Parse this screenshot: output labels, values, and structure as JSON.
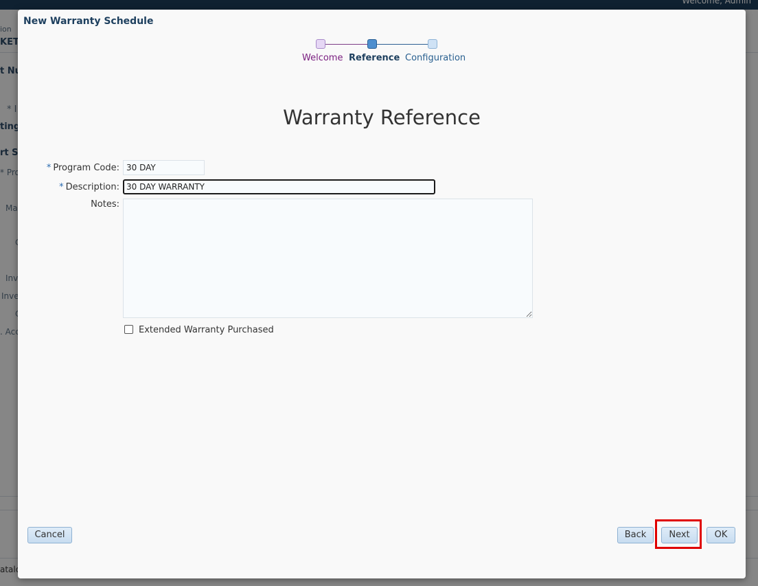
{
  "background": {
    "welcome_text": "Welcome, Admin",
    "side_fragments": [
      "ion",
      "KET",
      "t Nu",
      "* I",
      "ting",
      "rt Se",
      "* Pro",
      "Ma",
      "C",
      "Inv",
      "Inve",
      "C",
      ". Acc"
    ],
    "bottom_fragment": "atalo"
  },
  "dialog": {
    "title": "New Warranty Schedule",
    "train": {
      "steps": [
        {
          "label": "Welcome",
          "state": "visited"
        },
        {
          "label": "Reference",
          "state": "current"
        },
        {
          "label": "Configuration",
          "state": "unvisited"
        }
      ]
    },
    "heading": "Warranty Reference",
    "form": {
      "program_code": {
        "label": "Program Code:",
        "required": "*",
        "value": "30 DAY"
      },
      "description": {
        "label": "Description:",
        "required": "*",
        "value": "30 DAY WARRANTY"
      },
      "notes": {
        "label": "Notes:",
        "value": ""
      },
      "extended_warranty": {
        "label": "Extended Warranty Purchased",
        "checked": false
      }
    },
    "buttons": {
      "cancel": "Cancel",
      "back": "Back",
      "next": "Next",
      "ok": "OK"
    }
  },
  "colors": {
    "train_visited": "#7a1f80",
    "train_current": "#4e8fcf",
    "required_marker": "#2a6bb0",
    "highlight": "#e00000"
  }
}
